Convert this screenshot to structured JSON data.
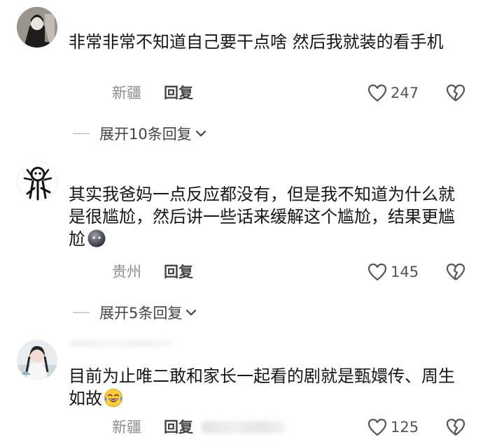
{
  "comments": [
    {
      "text": "非常非常不知道自己要干点啥 然后我就装的看手机",
      "location": "新疆",
      "reply_label": "回复",
      "likes": "247",
      "expand_label": "展开10条回复"
    },
    {
      "text": "其实我爸妈一点反应都没有，但是我不知道为什么就是很尴尬，然后讲一些话来缓解这个尴尬，结果更尴尬",
      "location": "贵州",
      "reply_label": "回复",
      "likes": "145",
      "expand_label": "展开5条回复"
    },
    {
      "text": "目前为止唯二敢和家长一起看的剧就是甄嬛传、周生如故",
      "location": "新疆",
      "reply_label": "回复",
      "likes": "125"
    }
  ],
  "icons": {
    "like": "heart-outline-icon",
    "dislike": "broken-heart-icon",
    "expand": "chevron-down-icon"
  },
  "colors": {
    "meta_text": "#8c8c8c",
    "body_text": "#161616",
    "icon_stroke": "#555555"
  }
}
